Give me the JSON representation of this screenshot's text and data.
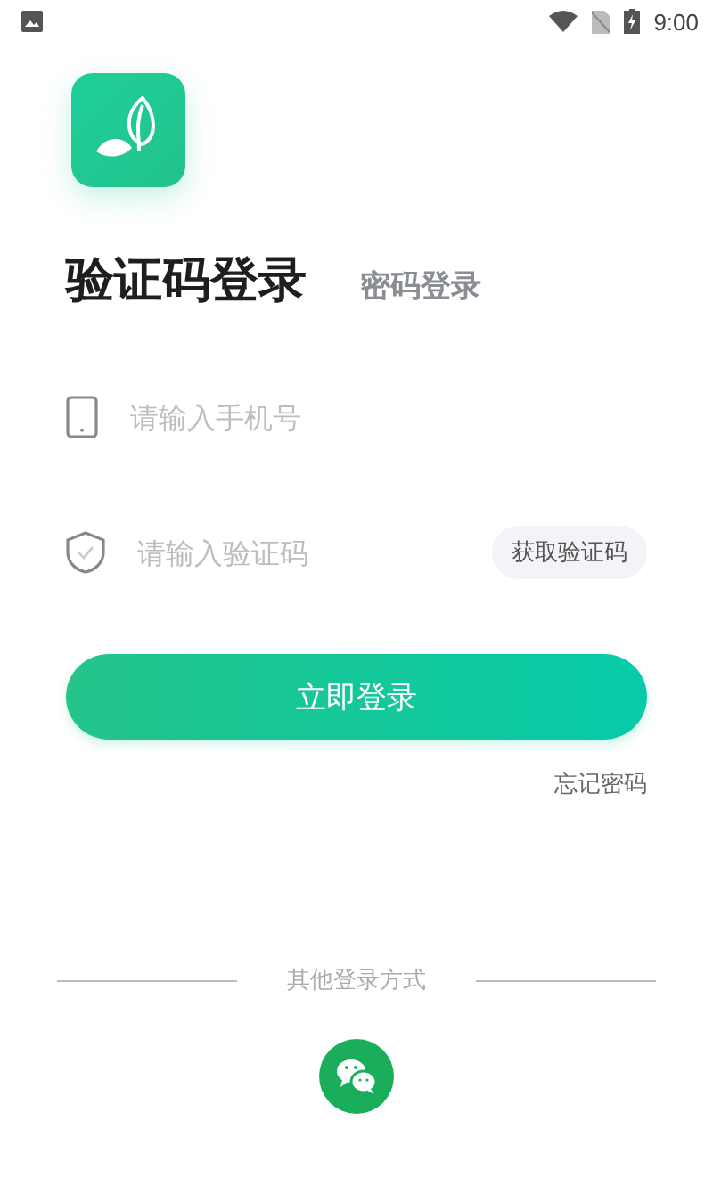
{
  "status_bar": {
    "time": "9:00"
  },
  "tabs": [
    {
      "label": "验证码登录",
      "selected": true
    },
    {
      "label": "密码登录",
      "selected": false
    }
  ],
  "fields": [
    {
      "kind": "phone",
      "placeholder": "请输入手机号"
    },
    {
      "kind": "code",
      "placeholder": "请输入验证码",
      "action": "获取验证码"
    }
  ],
  "login_button": "立即登录",
  "forgot_link": "忘记密码",
  "other_login": {
    "label": "其他登录方式"
  }
}
